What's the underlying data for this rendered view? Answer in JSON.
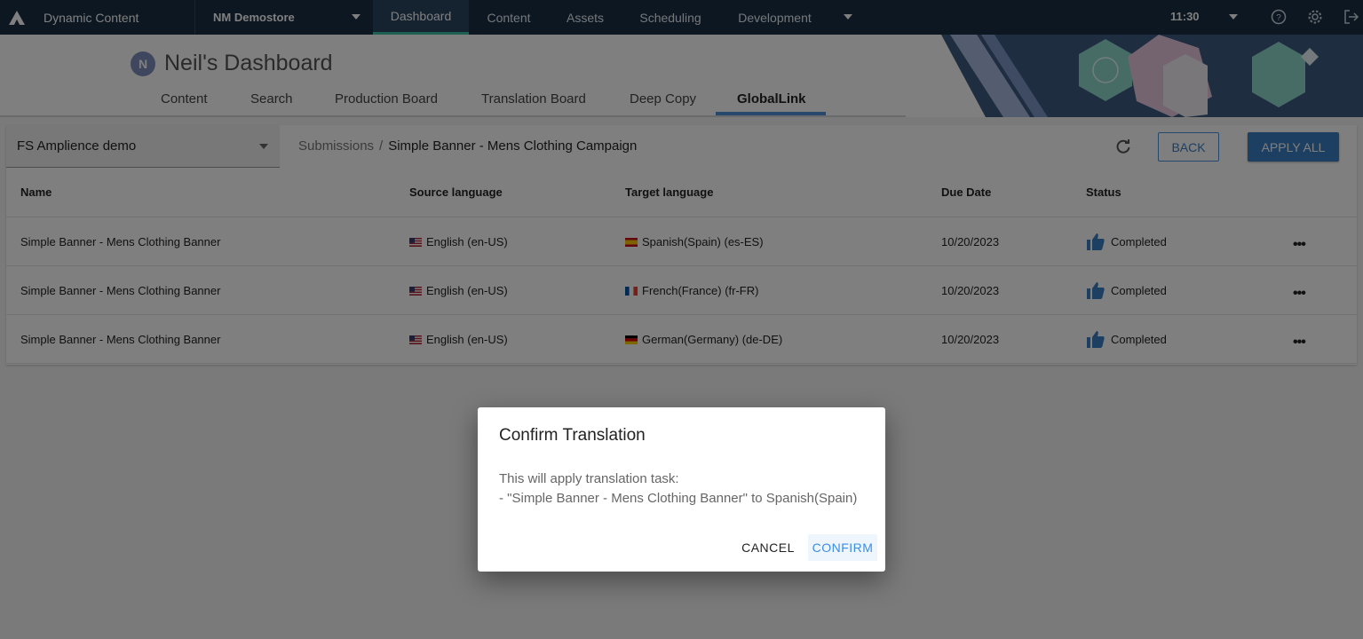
{
  "topnav": {
    "app_title": "Dynamic Content",
    "hub_name": "NM Demostore",
    "tabs": [
      {
        "label": "Dashboard",
        "active": true
      },
      {
        "label": "Content"
      },
      {
        "label": "Assets"
      },
      {
        "label": "Scheduling"
      },
      {
        "label": "Development"
      }
    ],
    "time": "11:30",
    "icons": [
      "help-icon",
      "gear-icon",
      "logout-icon"
    ],
    "accent": "#3ec1a7",
    "bg": "#1b2f44"
  },
  "header": {
    "avatar_initial": "N",
    "title": "Neil's Dashboard",
    "tabs": [
      "Content",
      "Search",
      "Production Board",
      "Translation Board",
      "Deep Copy",
      "GlobalLink"
    ],
    "active_tab": "GlobalLink"
  },
  "toolbar": {
    "hub_select": "FS Amplience demo",
    "breadcrumb_root": "Submissions",
    "breadcrumb_separator": "/",
    "breadcrumb_current": "Simple Banner - Mens Clothing Campaign",
    "back_label": "BACK",
    "apply_all_label": "APPLY ALL"
  },
  "table": {
    "headers": [
      "Name",
      "Source language",
      "Target language",
      "Due Date",
      "Status"
    ],
    "rows": [
      {
        "name": "Simple Banner - Mens Clothing Banner",
        "source": "English (en-US)",
        "target": "Spanish(Spain) (es-ES)",
        "due": "10/20/2023",
        "status": "Completed"
      },
      {
        "name": "Simple Banner - Mens Clothing Banner",
        "source": "English (en-US)",
        "target": "French(France) (fr-FR)",
        "due": "10/20/2023",
        "status": "Completed"
      },
      {
        "name": "Simple Banner - Mens Clothing Banner",
        "source": "English (en-US)",
        "target": "German(Germany) (de-DE)",
        "due": "10/20/2023",
        "status": "Completed"
      }
    ]
  },
  "dialog": {
    "title": "Confirm Translation",
    "line1": "This will apply translation task:",
    "line2": "- \"Simple Banner - Mens Clothing Banner\" to Spanish(Spain)",
    "cancel_label": "CANCEL",
    "confirm_label": "CONFIRM",
    "confirm_color": "#3a8ee6"
  }
}
